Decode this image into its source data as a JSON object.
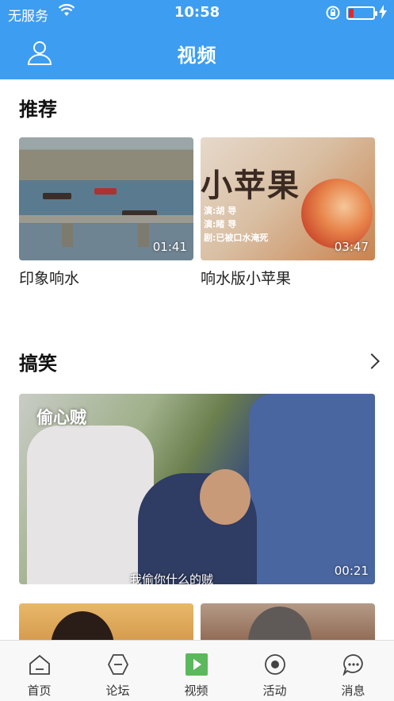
{
  "status_bar": {
    "carrier": "无服务",
    "time": "10:58",
    "icons": [
      "wifi-icon",
      "orientation-lock-icon",
      "battery-low-icon",
      "charging-bolt-icon"
    ],
    "battery_level": 0.1
  },
  "nav": {
    "title": "视频",
    "user_icon": "user-icon"
  },
  "recommend": {
    "title": "推荐",
    "items": [
      {
        "caption": "印象响水",
        "duration": "01:41"
      },
      {
        "caption": "响水版小苹果",
        "duration": "03:47",
        "overlay_title": "小苹果",
        "overlay_lines": [
          "演:胡 导",
          "演:睹 导",
          "剧:已被口水淹死"
        ]
      }
    ]
  },
  "funny": {
    "title": "搞笑",
    "more_icon": "chevron-right-icon",
    "featured": {
      "tag": "偷心贼",
      "duration": "00:21",
      "subtitle": "我偷你什么的贼"
    }
  },
  "tabs": [
    {
      "label": "首页",
      "icon": "home-icon",
      "active": false
    },
    {
      "label": "论坛",
      "icon": "forum-icon",
      "active": false
    },
    {
      "label": "视频",
      "icon": "video-play-icon",
      "active": true
    },
    {
      "label": "活动",
      "icon": "activity-icon",
      "active": false
    },
    {
      "label": "消息",
      "icon": "message-icon",
      "active": false
    }
  ],
  "colors": {
    "accent": "#3d9df0",
    "active_tab": "#5cb85c"
  }
}
